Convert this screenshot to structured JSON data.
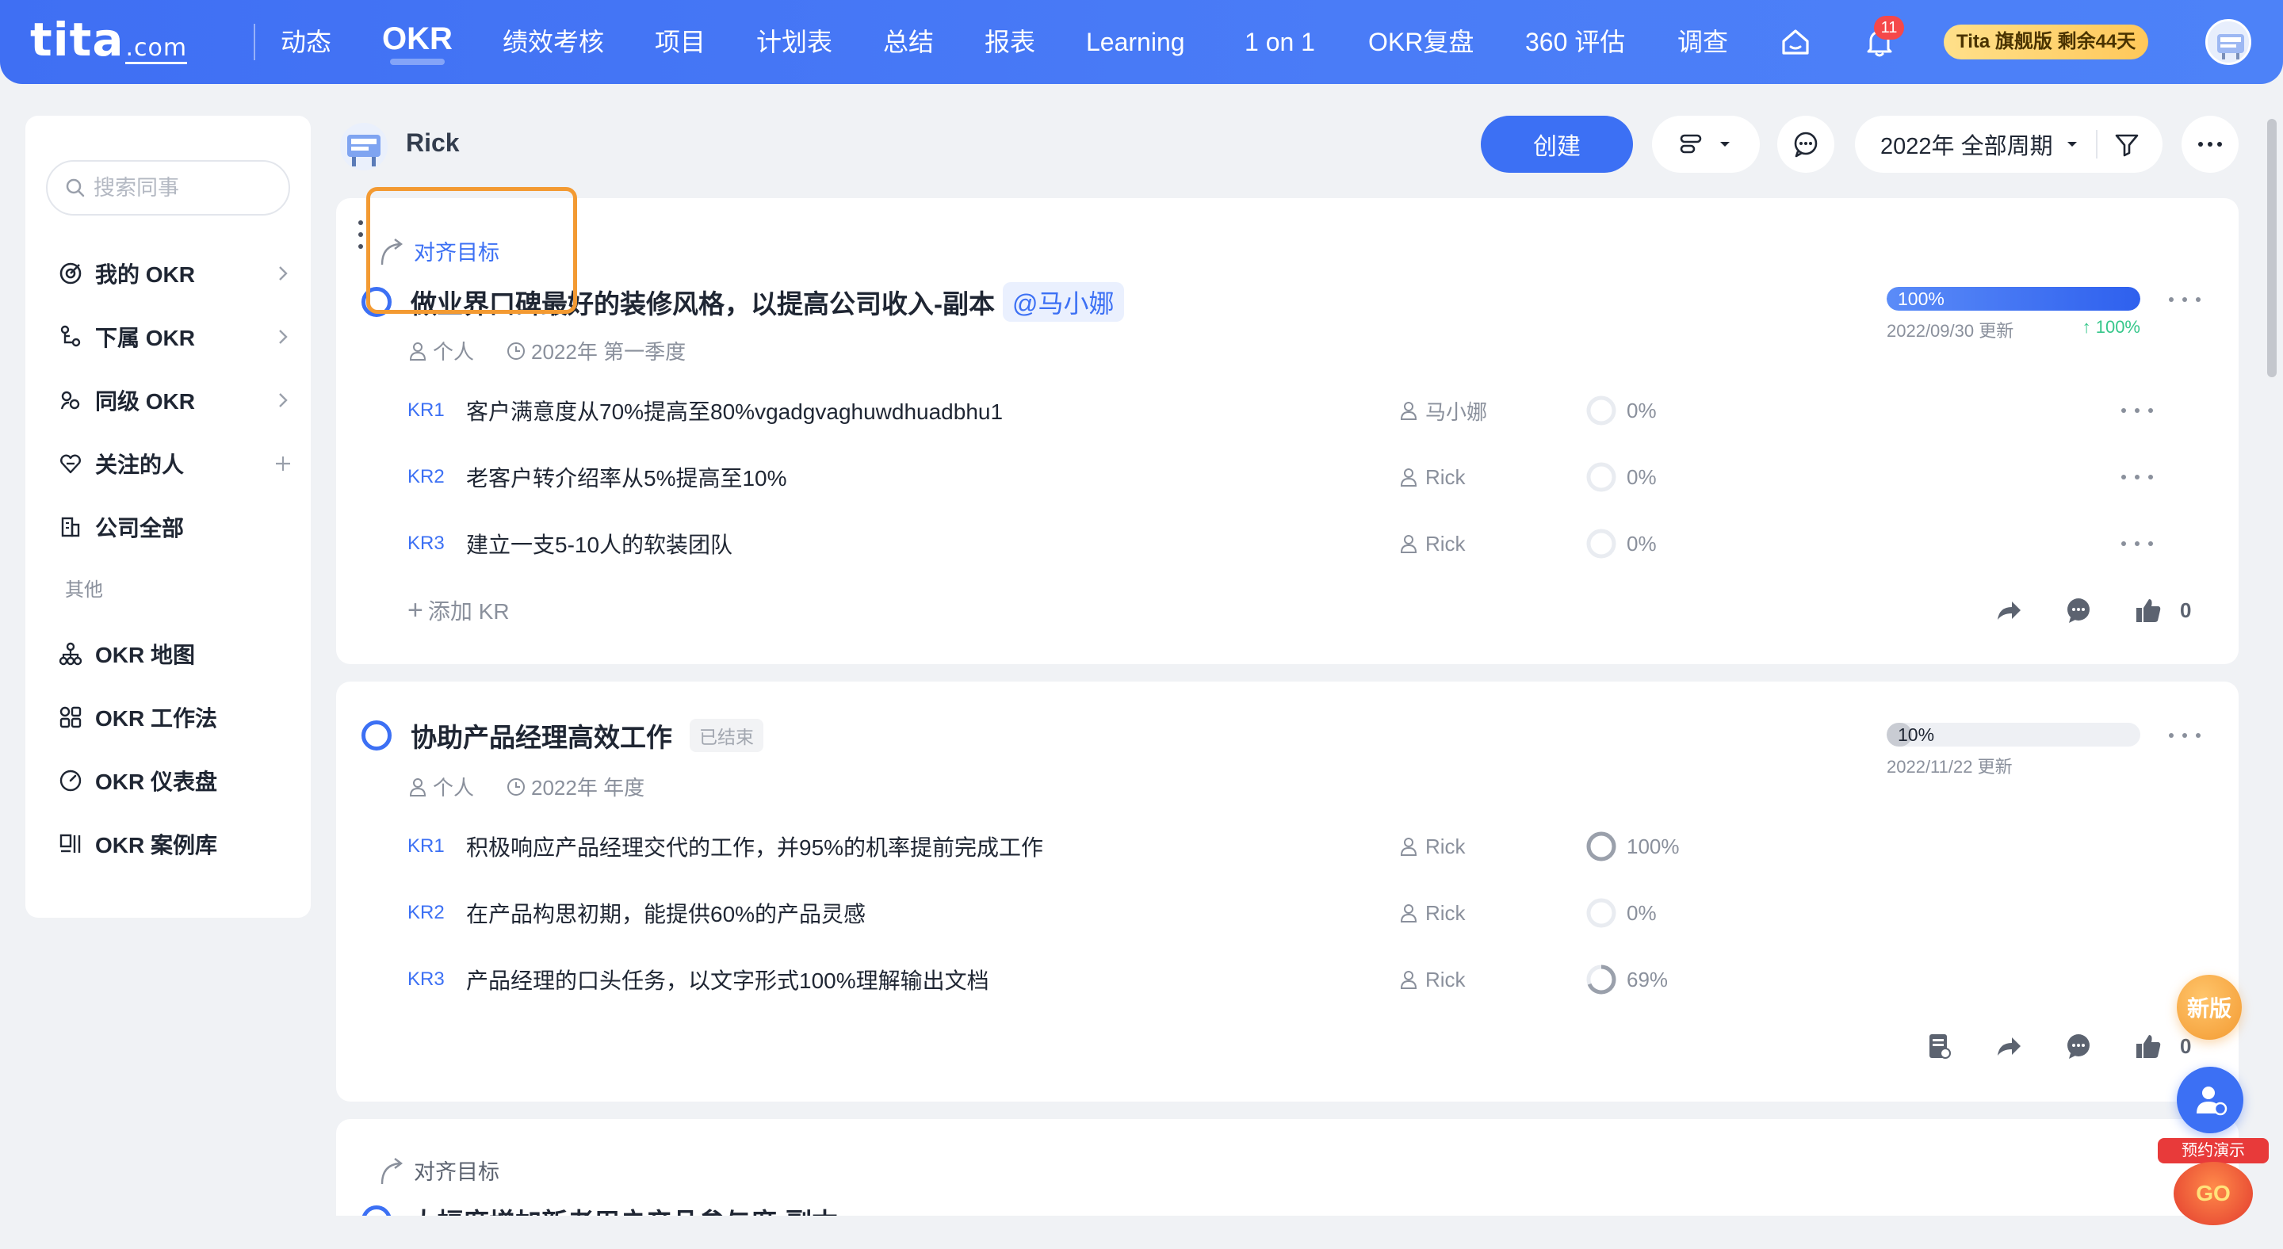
{
  "nav": {
    "logo": "tita",
    "logo_suffix": ".com",
    "items": [
      "动态",
      "OKR",
      "绩效考核",
      "项目",
      "计划表",
      "总结",
      "报表",
      "Learning",
      "1 on 1",
      "OKR复盘",
      "360 评估",
      "调查"
    ],
    "active": "OKR",
    "notification_count": "11",
    "trial_badge": "Tita 旗舰版 剩余44天",
    "icons": [
      "home-icon",
      "bell-icon",
      "user-avatar"
    ]
  },
  "sidebar": {
    "search_placeholder": "搜索同事",
    "items": [
      {
        "label": "我的 OKR",
        "icon": "target-icon",
        "trail": "chevron-right"
      },
      {
        "label": "下属 OKR",
        "icon": "subordinate-icon",
        "trail": "chevron-right"
      },
      {
        "label": "同级 OKR",
        "icon": "peer-icon",
        "trail": "chevron-right"
      },
      {
        "label": "关注的人",
        "icon": "heart-icon",
        "trail": "plus"
      },
      {
        "label": "公司全部",
        "icon": "building-icon",
        "trail": ""
      }
    ],
    "section_label": "其他",
    "other_items": [
      {
        "label": "OKR 地图",
        "icon": "map-icon"
      },
      {
        "label": "OKR 工作法",
        "icon": "grid-icon"
      },
      {
        "label": "OKR 仪表盘",
        "icon": "gauge-icon"
      },
      {
        "label": "OKR 案例库",
        "icon": "library-icon"
      }
    ]
  },
  "header": {
    "user_name": "Rick",
    "create_label": "创建",
    "period_label": "2022年 全部周期"
  },
  "objectives": [
    {
      "align_label": "对齐目标",
      "title": "做业界口碑最好的装修风格，以提高公司收入-副本",
      "mention": "@马小娜",
      "ended_tag": "",
      "owner_type": "个人",
      "period": "2022年 第一季度",
      "progress": 100,
      "progress_label": "100%",
      "updated": "2022/09/30 更新",
      "delta": "↑ 100%",
      "krs": [
        {
          "code": "KR1",
          "title": "客户满意度从70%提高至80%vgadgvaghuwdhuadbhu1",
          "owner": "马小娜",
          "progress": 0,
          "progress_label": "0%"
        },
        {
          "code": "KR2",
          "title": "老客户转介绍率从5%提高至10%",
          "owner": "Rick",
          "progress": 0,
          "progress_label": "0%"
        },
        {
          "code": "KR3",
          "title": "建立一支5-10人的软装团队",
          "owner": "Rick",
          "progress": 0,
          "progress_label": "0%"
        }
      ],
      "add_kr_label": "添加 KR",
      "like_count": "0"
    },
    {
      "align_label": "",
      "title": "协助产品经理高效工作",
      "mention": "",
      "ended_tag": "已结束",
      "owner_type": "个人",
      "period": "2022年 年度",
      "progress": 10,
      "progress_label": "10%",
      "updated": "2022/11/22 更新",
      "delta": "",
      "krs": [
        {
          "code": "KR1",
          "title": "积极响应产品经理交代的工作，并95%的机率提前完成工作",
          "owner": "Rick",
          "progress": 100,
          "progress_label": "100%"
        },
        {
          "code": "KR2",
          "title": "在产品构思初期，能提供60%的产品灵感",
          "owner": "Rick",
          "progress": 0,
          "progress_label": "0%"
        },
        {
          "code": "KR3",
          "title": "产品经理的口头任务，以文字形式100%理解输出文档",
          "owner": "Rick",
          "progress": 69,
          "progress_label": "69%"
        }
      ],
      "like_count": "0"
    },
    {
      "align_label": "对齐目标",
      "title": "大幅度增加新老用户产品参与度-副本"
    }
  ],
  "floating": {
    "new_version": "新版",
    "demo_label": "预约演示",
    "demo_go": "GO"
  },
  "colors": {
    "primary": "#3c70f4",
    "highlight": "#f39a32",
    "success": "#37c78b",
    "badge": "#f5484a"
  }
}
